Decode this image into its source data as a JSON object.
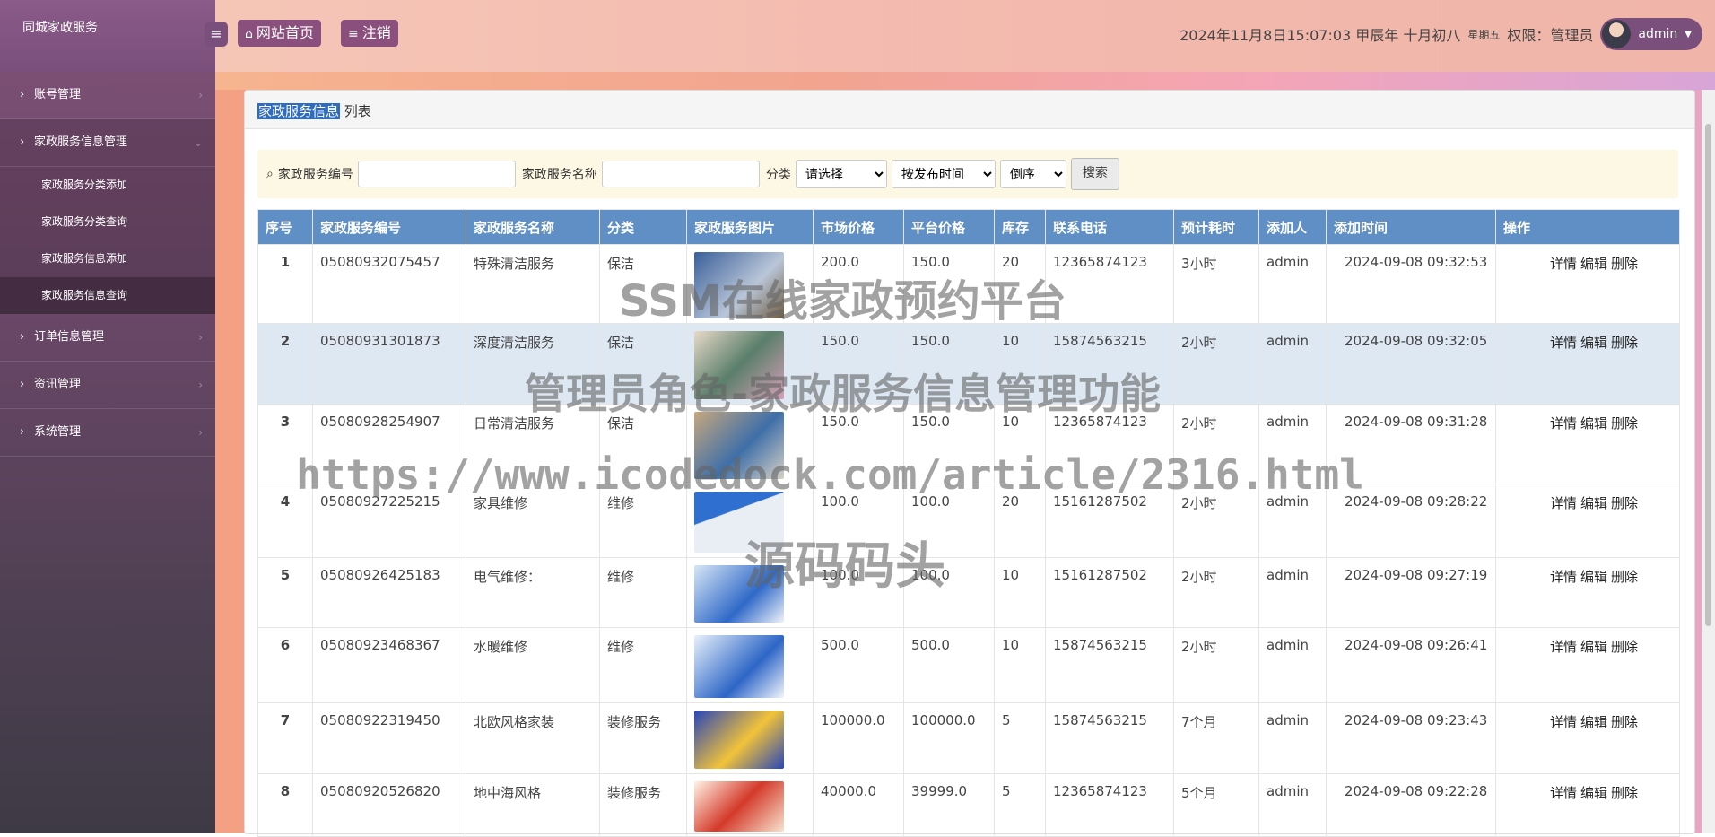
{
  "app": {
    "title": "同城家政服务",
    "nav_home": "网站首页",
    "nav_logout": "注销",
    "datetime": "2024年11月8日15:07:03 甲辰年 十月初八",
    "weekday": "星期五",
    "role_label": "权限：管理员",
    "user": "admin"
  },
  "sidebar": {
    "items": [
      {
        "label": "账号管理"
      },
      {
        "label": "家政服务信息管理"
      },
      {
        "label": "订单信息管理"
      },
      {
        "label": "资讯管理"
      },
      {
        "label": "系统管理"
      }
    ],
    "sub": [
      {
        "label": "家政服务分类添加"
      },
      {
        "label": "家政服务分类查询"
      },
      {
        "label": "家政服务信息添加"
      },
      {
        "label": "家政服务信息查询"
      }
    ]
  },
  "breadcrumb": {
    "highlight": "家政服务信息",
    "rest": "列表"
  },
  "search": {
    "label_no": "家政服务编号",
    "label_name": "家政服务名称",
    "label_cat": "分类",
    "select_cat": "请选择",
    "select_order": "按发布时间",
    "select_dir": "倒序",
    "button": "搜索"
  },
  "table": {
    "headers": [
      "序号",
      "家政服务编号",
      "家政服务名称",
      "分类",
      "家政服务图片",
      "市场价格",
      "平台价格",
      "库存",
      "联系电话",
      "预计耗时",
      "添加人",
      "添加时间",
      "操作"
    ],
    "ops": {
      "detail": "详情",
      "edit": "编辑",
      "delete": "删除"
    },
    "rows": [
      {
        "idx": "1",
        "no": "05080932075457",
        "name": "特殊清洁服务",
        "cat": "保洁",
        "market": "200.0",
        "price": "150.0",
        "stock": "20",
        "phone": "12365874123",
        "time": "3小时",
        "by": "admin",
        "added": "2024-09-08 09:32:53"
      },
      {
        "idx": "2",
        "no": "05080931301873",
        "name": "深度清洁服务",
        "cat": "保洁",
        "market": "150.0",
        "price": "150.0",
        "stock": "10",
        "phone": "15874563215",
        "time": "2小时",
        "by": "admin",
        "added": "2024-09-08 09:32:05"
      },
      {
        "idx": "3",
        "no": "05080928254907",
        "name": "日常清洁服务",
        "cat": "保洁",
        "market": "150.0",
        "price": "150.0",
        "stock": "10",
        "phone": "12365874123",
        "time": "2小时",
        "by": "admin",
        "added": "2024-09-08 09:31:28"
      },
      {
        "idx": "4",
        "no": "05080927225215",
        "name": "家具维修",
        "cat": "维修",
        "market": "100.0",
        "price": "100.0",
        "stock": "20",
        "phone": "15161287502",
        "time": "2小时",
        "by": "admin",
        "added": "2024-09-08 09:28:22"
      },
      {
        "idx": "5",
        "no": "05080926425183",
        "name": "电气维修：",
        "cat": "维修",
        "market": "100.0",
        "price": "100.0",
        "stock": "10",
        "phone": "15161287502",
        "time": "2小时",
        "by": "admin",
        "added": "2024-09-08 09:27:19"
      },
      {
        "idx": "6",
        "no": "05080923468367",
        "name": "水暖维修",
        "cat": "维修",
        "market": "500.0",
        "price": "500.0",
        "stock": "10",
        "phone": "15874563215",
        "time": "2小时",
        "by": "admin",
        "added": "2024-09-08 09:26:41"
      },
      {
        "idx": "7",
        "no": "05080922319450",
        "name": "北欧风格家装",
        "cat": "装修服务",
        "market": "100000.0",
        "price": "100000.0",
        "stock": "5",
        "phone": "15874563215",
        "time": "7个月",
        "by": "admin",
        "added": "2024-09-08 09:23:43"
      },
      {
        "idx": "8",
        "no": "05080920526820",
        "name": "地中海风格",
        "cat": "装修服务",
        "market": "40000.0",
        "price": "39999.0",
        "stock": "5",
        "phone": "12365874123",
        "time": "5个月",
        "by": "admin",
        "added": "2024-09-08 09:22:28"
      }
    ]
  },
  "watermark": {
    "line1": "SSM在线家政预约平台",
    "line2": "管理员角色-家政服务信息管理功能",
    "line3": "https://www.icodedock.com/article/2316.html",
    "line4": "源码码头"
  }
}
